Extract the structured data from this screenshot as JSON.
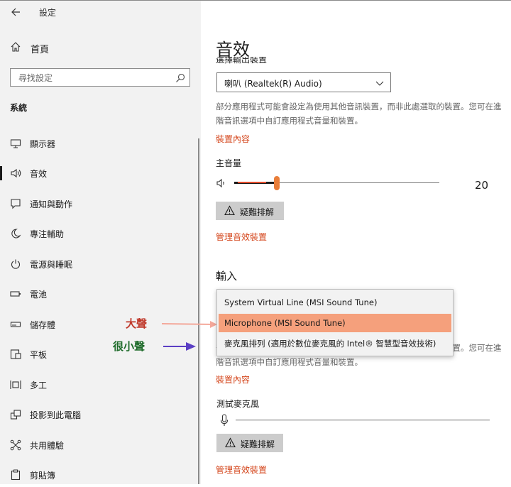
{
  "window": {
    "title": "設定"
  },
  "sidebar": {
    "home_label": "首頁",
    "search_placeholder": "尋找設定",
    "section_label": "系統",
    "items": [
      {
        "label": "顯示器",
        "icon": "monitor-icon"
      },
      {
        "label": "音效",
        "icon": "speaker-icon",
        "selected": true
      },
      {
        "label": "通知與動作",
        "icon": "notification-icon"
      },
      {
        "label": "專注輔助",
        "icon": "moon-icon"
      },
      {
        "label": "電源與睡眠",
        "icon": "power-icon"
      },
      {
        "label": "電池",
        "icon": "battery-icon"
      },
      {
        "label": "儲存體",
        "icon": "storage-icon"
      },
      {
        "label": "平板",
        "icon": "tablet-icon"
      },
      {
        "label": "多工",
        "icon": "multitask-icon"
      },
      {
        "label": "投影到此電腦",
        "icon": "project-icon"
      },
      {
        "label": "共用體驗",
        "icon": "shared-icon"
      },
      {
        "label": "剪貼簿",
        "icon": "clipboard-icon"
      }
    ]
  },
  "main": {
    "title": "音效",
    "output": {
      "label": "選擇輸出裝置",
      "device": "喇叭 (Realtek(R) Audio)",
      "description": "部分應用程式可能會設定為使用其他音訊裝置，而非此處選取的裝置。您可在進階音訊選項中自訂應用程式音量和裝置。",
      "device_properties": "裝置內容",
      "volume_label": "主音量",
      "volume_value": "20",
      "troubleshoot": "疑難排解",
      "manage_devices": "管理音效裝置"
    },
    "input": {
      "heading": "輸入",
      "options": [
        "System Virtual Line (MSI Sound Tune)",
        "Microphone (MSI Sound Tune)",
        "麥克風排列 (適用於數位麥克風的 Intel® 智慧型音效技術)"
      ],
      "highlighted_index": 1,
      "description": "部分應用程式可能會設定為使用其他音訊裝置，而非此處選取的裝置。您可在進階音訊選項中自訂應用程式音量和裝置。",
      "device_properties": "裝置內容",
      "test_mic_label": "測試麥克風",
      "troubleshoot": "疑難排解",
      "manage_devices": "管理音效裝置"
    }
  },
  "annotations": {
    "loud": "大聲",
    "quiet": "很小聲",
    "loud_arrow_color": "#f4a89a",
    "quiet_arrow_color": "#5b3fc4"
  },
  "colors": {
    "accent": "#d4451b",
    "highlight": "#f5a07c",
    "slider_thumb": "#e97e3a"
  }
}
